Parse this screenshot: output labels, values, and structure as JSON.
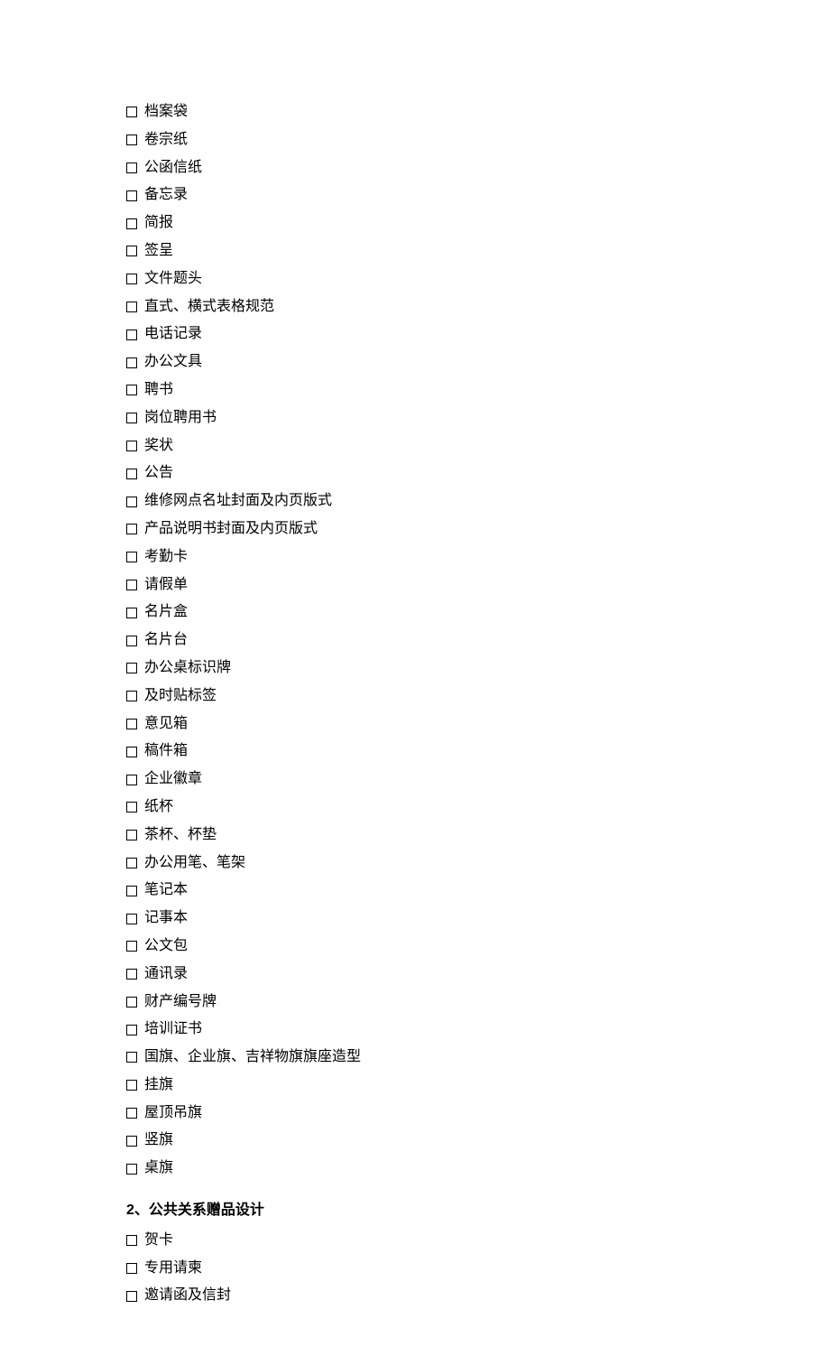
{
  "list1": [
    "档案袋",
    "卷宗纸",
    "公函信纸",
    "备忘录",
    "简报",
    "签呈",
    " 文件题头",
    "直式、横式表格规范",
    "电话记录",
    "办公文具",
    "聘书",
    "岗位聘用书",
    "奖状",
    "公告",
    "维修网点名址封面及内页版式",
    "产品说明书封面及内页版式",
    "考勤卡",
    "请假单",
    "名片盒",
    "名片台",
    "办公桌标识牌",
    "及时贴标签",
    "意见箱",
    "稿件箱",
    "企业徽章",
    "纸杯",
    "茶杯、杯垫",
    "办公用笔、笔架",
    "笔记本",
    "记事本",
    "公文包",
    "通讯录",
    "财产编号牌",
    "培训证书",
    "国旗、企业旗、吉祥物旗旗座造型",
    "挂旗",
    "屋顶吊旗",
    "竖旗",
    "桌旗"
  ],
  "section2": {
    "heading": "2、公共关系赠品设计",
    "items": [
      "贺卡",
      "专用请柬",
      "邀请函及信封"
    ]
  }
}
